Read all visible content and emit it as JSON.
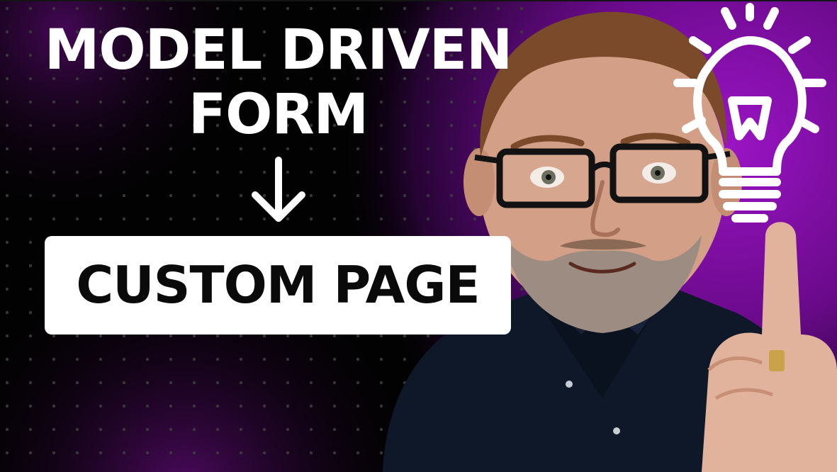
{
  "thumbnail": {
    "title_line_1": "MODEL DRIVEN",
    "title_line_2": "FORM",
    "arrow_icon": "down-arrow-icon",
    "target_label": "CUSTOM PAGE",
    "bulb_icon": "lightbulb-icon"
  },
  "colors": {
    "background": "#000000",
    "accent_purple": "#8a0fb0",
    "text_light": "#ffffff",
    "text_dark": "#0a0a0a",
    "label_box": "#ffffff"
  }
}
